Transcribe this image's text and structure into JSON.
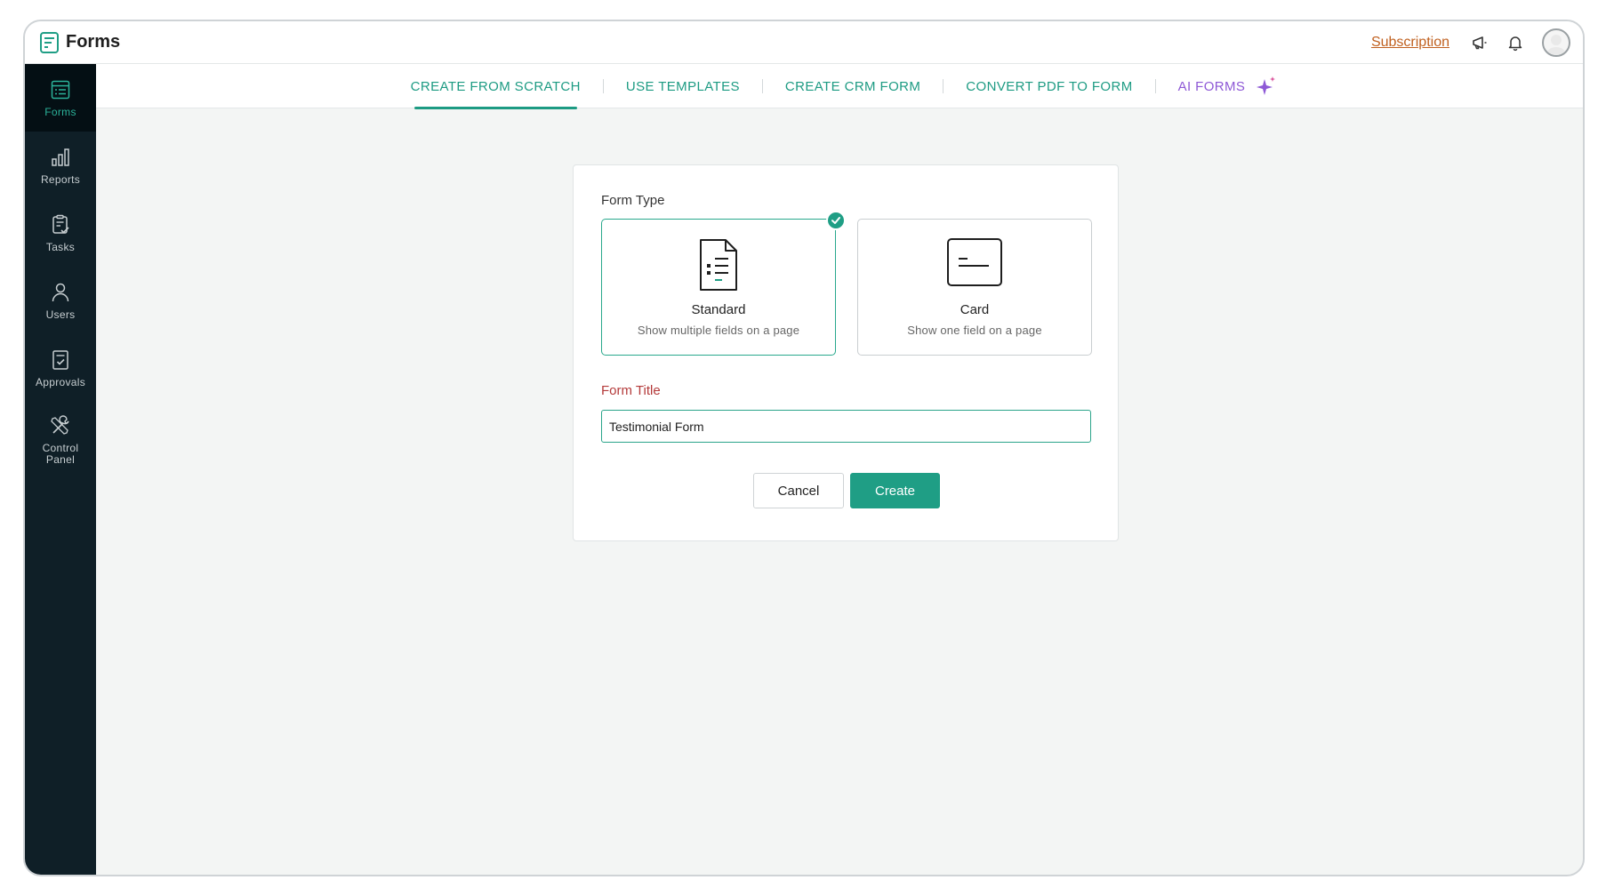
{
  "app": {
    "name": "Forms"
  },
  "header": {
    "subscription_label": "Subscription",
    "icons": [
      "announcement-icon",
      "bell-icon",
      "avatar"
    ]
  },
  "sidebar": {
    "items": [
      {
        "label": "Forms",
        "icon": "forms-icon",
        "active": true
      },
      {
        "label": "Reports",
        "icon": "bar-chart-icon",
        "active": false
      },
      {
        "label": "Tasks",
        "icon": "tasks-icon",
        "active": false
      },
      {
        "label": "Users",
        "icon": "user-icon",
        "active": false
      },
      {
        "label": "Approvals",
        "icon": "approvals-icon",
        "active": false
      },
      {
        "label": "Control\nPanel",
        "icon": "tools-icon",
        "active": false
      }
    ]
  },
  "tabs": [
    {
      "label": "CREATE FROM SCRATCH",
      "active": true
    },
    {
      "label": "USE TEMPLATES",
      "active": false
    },
    {
      "label": "CREATE CRM FORM",
      "active": false
    },
    {
      "label": "CONVERT PDF TO FORM",
      "active": false
    },
    {
      "label": "AI FORMS",
      "active": false
    }
  ],
  "form": {
    "type_label": "Form Type",
    "types": [
      {
        "name": "Standard",
        "description": "Show multiple fields on a page",
        "selected": true
      },
      {
        "name": "Card",
        "description": "Show one field on a page",
        "selected": false
      }
    ],
    "title_label": "Form Title",
    "title_value": "Testimonial Form",
    "cancel_label": "Cancel",
    "create_label": "Create"
  },
  "colors": {
    "accent": "#1f9e85",
    "sidebar_bg": "#0f1f27",
    "ai_purple": "#8e59d6",
    "required_red": "#b43a3a",
    "subscription_orange": "#c0601f"
  }
}
